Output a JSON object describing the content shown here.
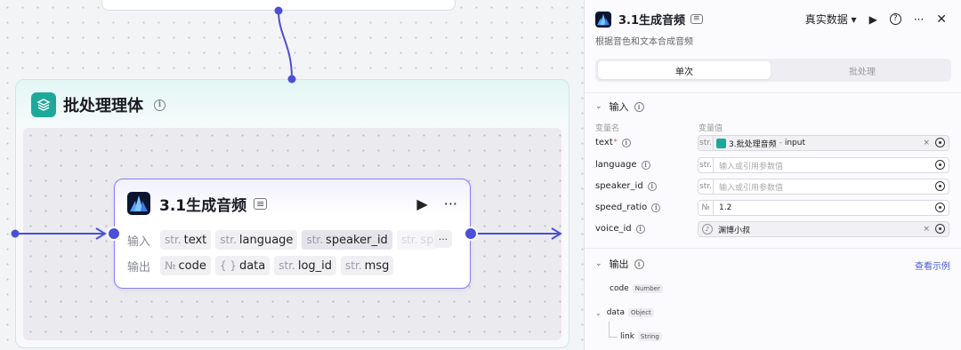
{
  "canvas": {
    "batch": {
      "title": "批处理理体"
    },
    "node": {
      "title": "3.1生成音频",
      "input_label": "输入",
      "output_label": "输出",
      "inputs": [
        {
          "type": "str.",
          "name": "text"
        },
        {
          "type": "str.",
          "name": "language"
        },
        {
          "type": "str.",
          "name": "speaker_id"
        },
        {
          "type": "str.",
          "name": "sp"
        }
      ],
      "outputs": [
        {
          "type": "№",
          "name": "code"
        },
        {
          "type": "{ }",
          "name": "data"
        },
        {
          "type": "str.",
          "name": "log_id"
        },
        {
          "type": "str.",
          "name": "msg"
        }
      ]
    }
  },
  "panel": {
    "title": "3.1生成音频",
    "subtitle": "根据音色和文本合成音频",
    "data_mode": "真实数据",
    "tabs": {
      "single": "单次",
      "batch": "批处理"
    },
    "input_section": "输入",
    "col_name": "变量名",
    "col_value": "变量值",
    "params": [
      {
        "name": "text",
        "type": "str.",
        "ref_node": "3.批处理音频",
        "ref_sep": "-",
        "ref_var": "input",
        "clear": "×"
      },
      {
        "name": "language",
        "type": "str.",
        "placeholder": "输入或引用参数值"
      },
      {
        "name": "speaker_id",
        "type": "str.",
        "placeholder": "输入或引用参数值"
      },
      {
        "name": "speed_ratio",
        "type": "№",
        "value": "1.2"
      },
      {
        "name": "voice_id",
        "value": "渊博小叔",
        "clear": "×"
      }
    ],
    "output_section": "输出",
    "see_example": "查看示例",
    "outputs": [
      {
        "name": "code",
        "type": "Number"
      },
      {
        "name": "data",
        "type": "Object"
      },
      {
        "name": "link",
        "type": "String"
      }
    ]
  },
  "colors": {
    "accent": "#5b4fe0",
    "batch": "#1ea89a"
  }
}
